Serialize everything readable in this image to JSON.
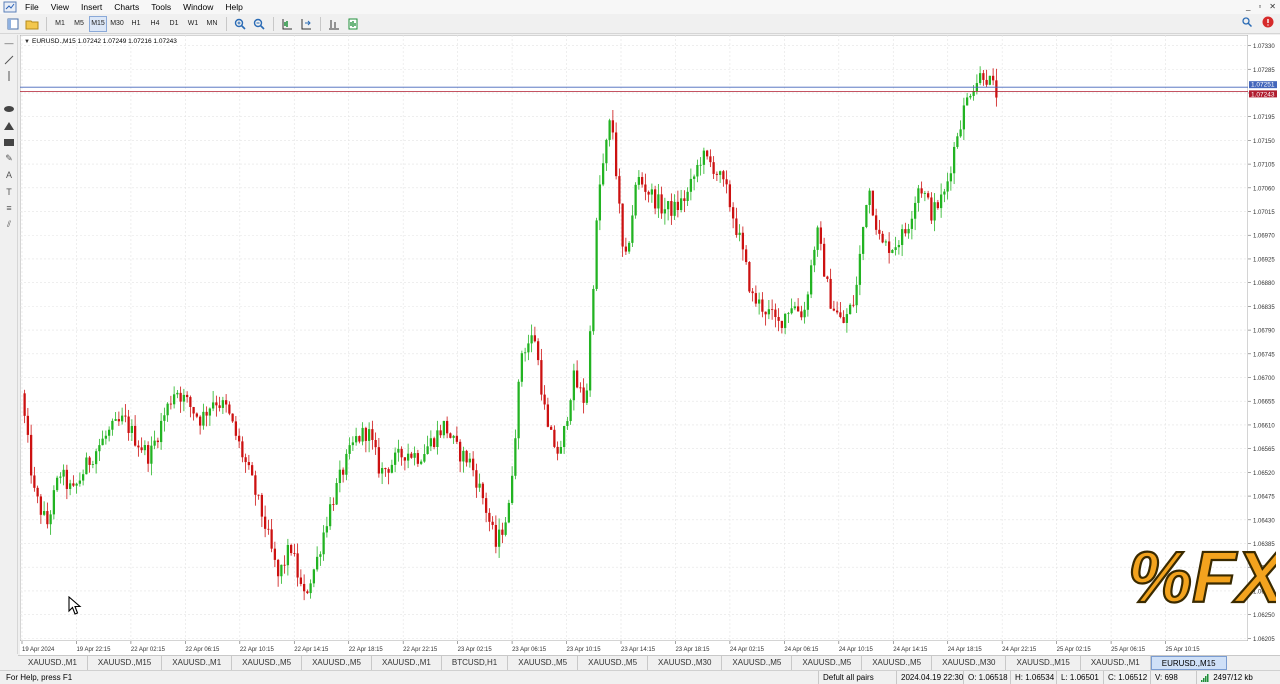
{
  "menu": [
    "File",
    "View",
    "Insert",
    "Charts",
    "Tools",
    "Window",
    "Help"
  ],
  "timeframes": [
    "M1",
    "M5",
    "M15",
    "M30",
    "H1",
    "H4",
    "D1",
    "W1",
    "MN"
  ],
  "active_timeframe": "M15",
  "chart": {
    "symbol_header": "EURUSD.,M15  1.07242 1.07249 1.07216 1.07243",
    "price_tag_ask": "1.07251",
    "price_tag_bid": "1.07243"
  },
  "chart_data": {
    "type": "candlestick",
    "ylim": [
      1.062,
      1.0735
    ],
    "y_ticks": [
      "1.07330",
      "1.07285",
      "1.07240",
      "1.07195",
      "1.07150",
      "1.07105",
      "1.07060",
      "1.07015",
      "1.06970",
      "1.06925",
      "1.06880",
      "1.06835",
      "1.06790",
      "1.06745",
      "1.06700",
      "1.06655",
      "1.06610",
      "1.06565",
      "1.06520",
      "1.06475",
      "1.06430",
      "1.06385",
      "1.06340",
      "1.06295",
      "1.06250",
      "1.06205"
    ],
    "x_ticks": [
      "19 Apr 2024",
      "19 Apr 22:15",
      "22 Apr 02:15",
      "22 Apr 06:15",
      "22 Apr 10:15",
      "22 Apr 14:15",
      "22 Apr 18:15",
      "22 Apr 22:15",
      "23 Apr 02:15",
      "23 Apr 06:15",
      "23 Apr 10:15",
      "23 Apr 14:15",
      "23 Apr 18:15",
      "24 Apr 02:15",
      "24 Apr 06:15",
      "24 Apr 10:15",
      "24 Apr 14:15",
      "24 Apr 18:15",
      "24 Apr 22:15",
      "25 Apr 02:15",
      "25 Apr 06:15",
      "25 Apr 10:15"
    ],
    "close_path": [
      1.0667,
      1.0648,
      1.0642,
      1.0652,
      1.0648,
      1.0653,
      1.0657,
      1.066,
      1.0662,
      1.0658,
      1.0655,
      1.0662,
      1.0668,
      1.0665,
      1.0662,
      1.0666,
      1.0664,
      1.0657,
      1.065,
      1.0642,
      1.0632,
      1.0638,
      1.0628,
      1.0635,
      1.0645,
      1.0652,
      1.0658,
      1.066,
      1.0652,
      1.0654,
      1.0656,
      1.0655,
      1.0658,
      1.0661,
      1.0656,
      1.0654,
      1.0647,
      1.0638,
      1.0645,
      1.0675,
      1.0678,
      1.066,
      1.0655,
      1.067,
      1.0665,
      1.0705,
      1.072,
      1.069,
      1.0708,
      1.0705,
      1.0702,
      1.0702,
      1.0705,
      1.0712,
      1.071,
      1.0705,
      1.0696,
      1.0685,
      1.0683,
      1.068,
      1.0684,
      1.0682,
      1.0698,
      1.0685,
      1.068,
      1.0685,
      1.0707,
      1.0695,
      1.0695,
      1.0698,
      1.0707,
      1.0701,
      1.0705,
      1.0717,
      1.0725,
      1.0728,
      1.0724
    ],
    "last_price": 1.07243
  },
  "tabs": [
    "XAUUSD.,M1",
    "XAUUSD.,M15",
    "XAUUSD.,M1",
    "XAUUSD.,M5",
    "XAUUSD.,M5",
    "XAUUSD.,M1",
    "BTCUSD,H1",
    "XAUUSD.,M5",
    "XAUUSD.,M5",
    "XAUUSD.,M30",
    "XAUUSD.,M5",
    "XAUUSD.,M5",
    "XAUUSD.,M5",
    "XAUUSD.,M30",
    "XAUUSD.,M15",
    "XAUUSD.,M1",
    "EURUSD.,M15"
  ],
  "active_tab_index": 16,
  "status": {
    "help": "For Help, press F1",
    "profile": "Defult all pairs",
    "datetime": "2024.04.19 22:30",
    "open": "O: 1.06518",
    "high": "H: 1.06534",
    "low": "L: 1.06501",
    "close": "C: 1.06512",
    "volume": "V: 698",
    "traffic": "2497/12 kb"
  },
  "logo_text": "%FX",
  "colors": {
    "bull": "#22b322",
    "bear": "#cc1111",
    "bid_line": "#b01c2e",
    "ask_line": "#4466bb",
    "grid": "#e3e3e3"
  }
}
